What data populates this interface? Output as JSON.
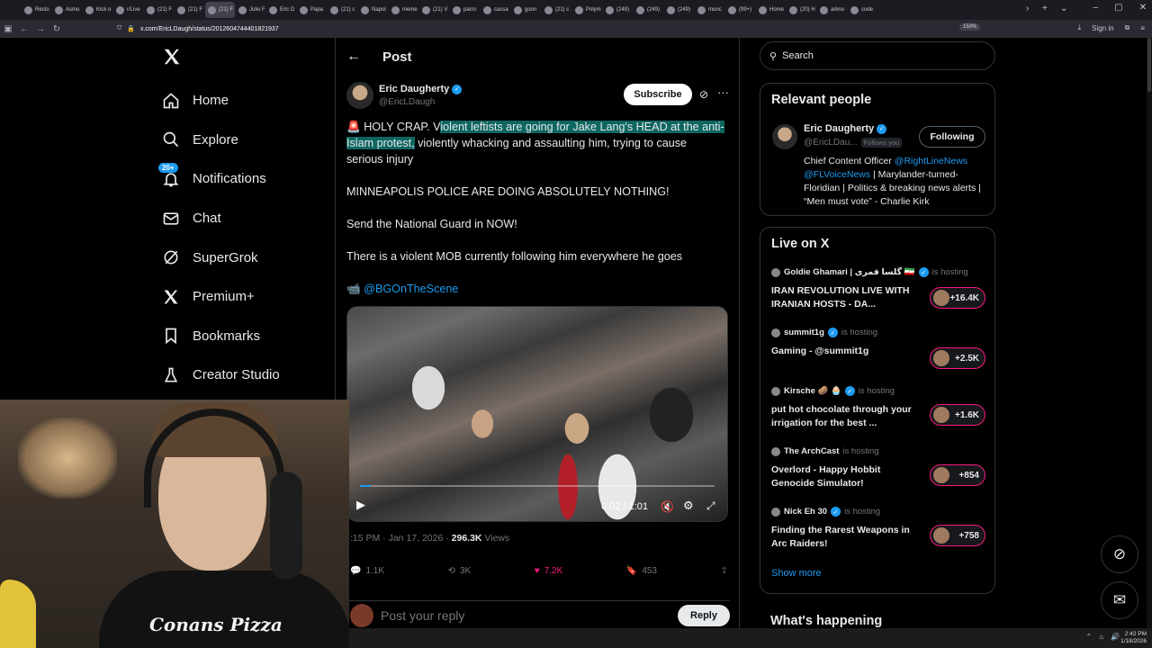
{
  "browser": {
    "tabs": [
      "Resto",
      "Asmo",
      "Kick o",
      "r/Live",
      "(21) F",
      "(21) F",
      "(21) F",
      "Julio F",
      "Eric D",
      "Papa",
      "(21) c",
      "Napol",
      "meme",
      "(21) V",
      "parro",
      "cassa",
      "goon",
      "(21) c",
      "Polym",
      "(249)",
      "(249)",
      "(249)",
      "munc",
      "(99+)",
      "Home",
      "(20) H",
      "arkno",
      "code"
    ],
    "active_tab_index": 6,
    "url": "x.com/EricLDaugh/status/2012604744401821937",
    "zoom": "150%",
    "sign_in": "Sign in"
  },
  "left_nav": {
    "items": [
      {
        "label": "Home",
        "icon": "home-icon"
      },
      {
        "label": "Explore",
        "icon": "search-icon"
      },
      {
        "label": "Notifications",
        "icon": "bell-icon",
        "badge": "20+"
      },
      {
        "label": "Chat",
        "icon": "mail-icon"
      },
      {
        "label": "SuperGrok",
        "icon": "grok-icon"
      },
      {
        "label": "Premium+",
        "icon": "x-icon"
      },
      {
        "label": "Bookmarks",
        "icon": "bookmark-icon"
      },
      {
        "label": "Creator Studio",
        "icon": "flask-icon"
      }
    ]
  },
  "post": {
    "header_title": "Post",
    "author_name": "Eric Daugherty",
    "author_handle": "@EricLDaugh",
    "subscribe_label": "Subscribe",
    "line1_prefix": "HOLY CRAP. V",
    "line1_highlight": "iolent leftists are going for Jake Lang's HEAD at the anti-Islam protest,",
    "line1_rest": " violently whacking and assaulting him, trying to cause serious injury",
    "para2": "MINNEAPOLIS POLICE ARE DOING ABSOLUTELY NOTHING!",
    "para3": "Send the National Guard in NOW!",
    "para4": "There is a violent MOB currently following him everywhere he goes",
    "credit_mention": "@BGOnTheScene",
    "video_time": "0:02 / 1:01",
    "video_progress": 0.03,
    "timestamp": ":15 PM · Jan 17, 2026 · ",
    "views_count": "296.3K",
    "views_label": " Views",
    "replies": "1.1K",
    "reposts": "3K",
    "likes": "7.2K",
    "bookmarks": "453",
    "reply_placeholder": "Post your reply",
    "reply_button": "Reply"
  },
  "right": {
    "search_placeholder": "Search",
    "relevant_title": "Relevant people",
    "rp_name": "Eric Daugherty",
    "rp_handle": "@EricLDau...",
    "rp_follows_you": "Follows you",
    "rp_following": "Following",
    "rp_bio_1": "Chief Content Officer ",
    "rp_bio_m1": "@RightLineNews",
    "rp_bio_m2": "@FLVoiceNews",
    "rp_bio_2": " | Marylander-turned-Floridian | Politics & breaking news alerts | “Men must vote” - Charlie Kirk",
    "live_title": "Live on X",
    "live": [
      {
        "host": "Goldie Ghamari | گلسا قمری 🇮🇷",
        "hosting": "is hosting",
        "title": "IRAN REVOLUTION LIVE WITH IRANIAN HOSTS - DA...",
        "count": "+16.4K"
      },
      {
        "host": "summit1g",
        "hosting": "is hosting",
        "title": "Gaming - @summit1g",
        "count": "+2.5K"
      },
      {
        "host": "Kirsche 🥔 🧁",
        "hosting": "is hosting",
        "title": "put hot chocolate through your irrigation for the best ...",
        "count": "+1.6K"
      },
      {
        "host": "The ArchCast",
        "hosting": "is hosting",
        "title": "Overlord - Happy Hobbit Genocide Simulator!",
        "count": "+854"
      },
      {
        "host": "Nick Eh 30",
        "hosting": "is hosting",
        "title": "Finding the Rarest Weapons in Arc Raiders!",
        "count": "+758"
      }
    ],
    "show_more": "Show more",
    "whats_happening": "What's happening"
  },
  "webcam": {
    "shirt_logo": "Conans Pizza"
  },
  "taskbar": {
    "time": "2:42 PM",
    "date": "1/18/2026"
  }
}
